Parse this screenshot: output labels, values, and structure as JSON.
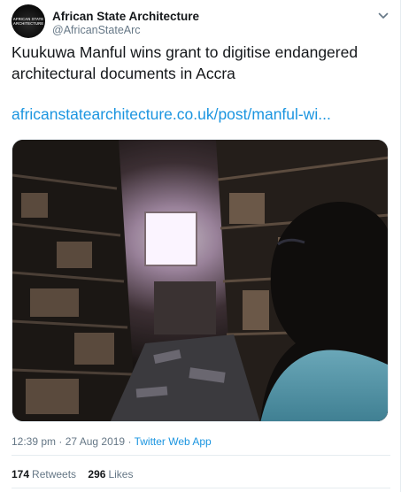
{
  "author": {
    "display_name": "African State Architecture",
    "handle": "@AfricanStateArc",
    "avatar_lines": [
      "AFRICAN STATE",
      "ARCHITECTURE"
    ]
  },
  "tweet": {
    "text": "Kuukuwa Manful wins grant to digitise endangered architectural documents in Accra",
    "link": "africanstatearchitecture.co.uk/post/manful-wi..."
  },
  "meta": {
    "timestamp": "12:39 pm · 27 Aug 2019",
    "separator": "·",
    "source": "Twitter Web App"
  },
  "stats": {
    "retweets_count": "174",
    "retweets_label": "Retweets",
    "likes_count": "296",
    "likes_label": "Likes"
  },
  "icons": {
    "menu": "chevron-down-icon"
  },
  "colors": {
    "link": "#1b95e0",
    "secondary_text": "#657786",
    "primary_text": "#14171a",
    "border": "#e6ecf0"
  }
}
